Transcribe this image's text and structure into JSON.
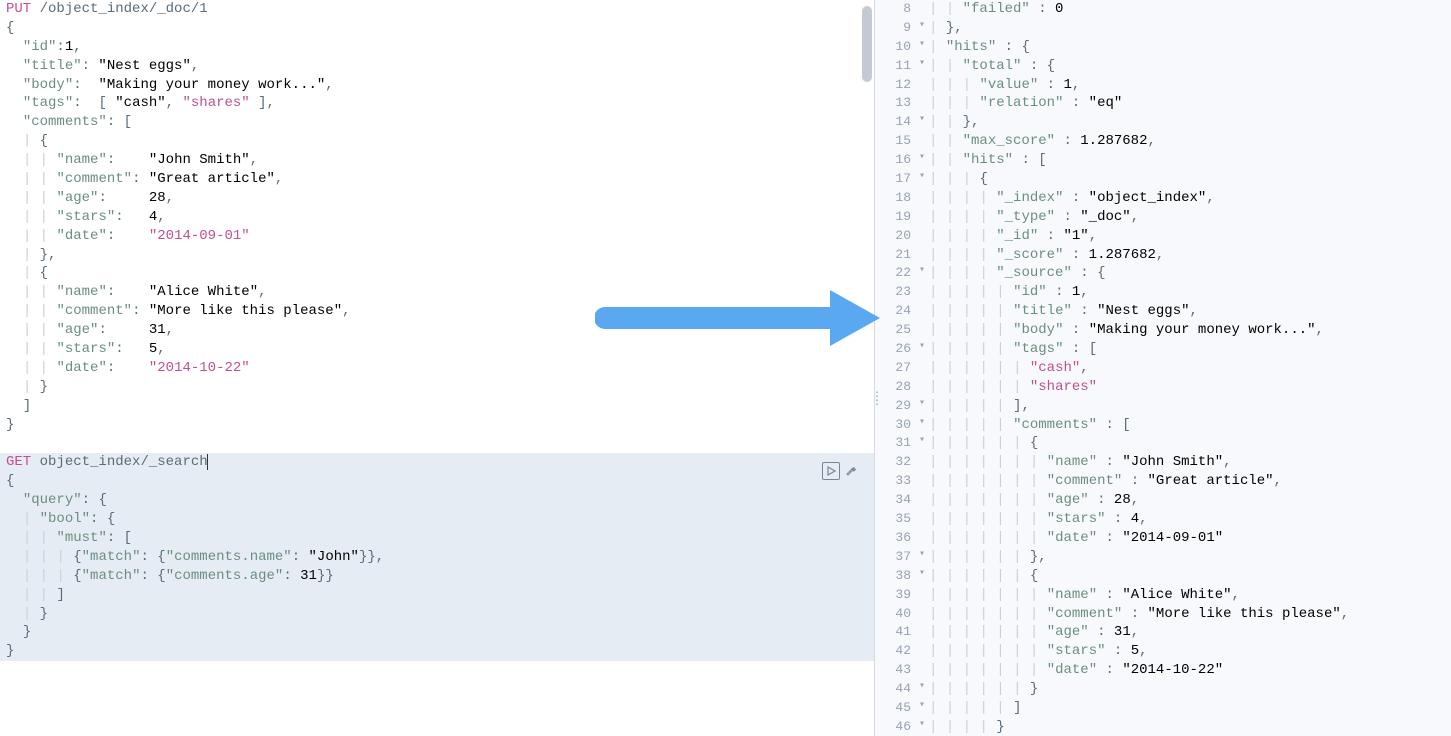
{
  "left": {
    "request1": {
      "method": "PUT",
      "path": "/object_index/_doc/1",
      "body_lines": [
        "{",
        "  \"id\":1,",
        "  \"title\": \"Nest eggs\",",
        "  \"body\":  \"Making your money work...\",",
        "  \"tags\":  [ \"cash\", \"shares\" ],",
        "  \"comments\": [",
        "    {",
        "      \"name\":    \"John Smith\",",
        "      \"comment\": \"Great article\",",
        "      \"age\":     28,",
        "      \"stars\":   4,",
        "      \"date\":    \"2014-09-01\"",
        "    },",
        "    {",
        "      \"name\":    \"Alice White\",",
        "      \"comment\": \"More like this please\",",
        "      \"age\":     31,",
        "      \"stars\":   5,",
        "      \"date\":    \"2014-10-22\"",
        "    }",
        "  ]",
        "}"
      ]
    },
    "request2": {
      "method": "GET",
      "path": "object_index/_search",
      "body_lines": [
        "{",
        "  \"query\": {",
        "    \"bool\": {",
        "      \"must\": [",
        "        {\"match\": {\"comments.name\": \"John\"}},",
        "        {\"match\": {\"comments.age\": 31}}",
        "      ]",
        "    }",
        "  }",
        "}"
      ]
    }
  },
  "right": {
    "lines": [
      {
        "n": 8,
        "f": "",
        "t": "    \"failed\" : 0"
      },
      {
        "n": 9,
        "f": "▾",
        "t": "  },"
      },
      {
        "n": 10,
        "f": "▾",
        "t": "  \"hits\" : {"
      },
      {
        "n": 11,
        "f": "▾",
        "t": "    \"total\" : {"
      },
      {
        "n": 12,
        "f": "",
        "t": "      \"value\" : 1,"
      },
      {
        "n": 13,
        "f": "",
        "t": "      \"relation\" : \"eq\""
      },
      {
        "n": 14,
        "f": "▾",
        "t": "    },"
      },
      {
        "n": 15,
        "f": "",
        "t": "    \"max_score\" : 1.287682,"
      },
      {
        "n": 16,
        "f": "▾",
        "t": "    \"hits\" : ["
      },
      {
        "n": 17,
        "f": "▾",
        "t": "      {"
      },
      {
        "n": 18,
        "f": "",
        "t": "        \"_index\" : \"object_index\","
      },
      {
        "n": 19,
        "f": "",
        "t": "        \"_type\" : \"_doc\","
      },
      {
        "n": 20,
        "f": "",
        "t": "        \"_id\" : \"1\","
      },
      {
        "n": 21,
        "f": "",
        "t": "        \"_score\" : 1.287682,"
      },
      {
        "n": 22,
        "f": "▾",
        "t": "        \"_source\" : {"
      },
      {
        "n": 23,
        "f": "",
        "t": "          \"id\" : 1,"
      },
      {
        "n": 24,
        "f": "",
        "t": "          \"title\" : \"Nest eggs\","
      },
      {
        "n": 25,
        "f": "",
        "t": "          \"body\" : \"Making your money work...\","
      },
      {
        "n": 26,
        "f": "▾",
        "t": "          \"tags\" : ["
      },
      {
        "n": 27,
        "f": "",
        "t": "            \"cash\","
      },
      {
        "n": 28,
        "f": "",
        "t": "            \"shares\""
      },
      {
        "n": 29,
        "f": "▾",
        "t": "          ],"
      },
      {
        "n": 30,
        "f": "▾",
        "t": "          \"comments\" : ["
      },
      {
        "n": 31,
        "f": "▾",
        "t": "            {"
      },
      {
        "n": 32,
        "f": "",
        "t": "              \"name\" : \"John Smith\","
      },
      {
        "n": 33,
        "f": "",
        "t": "              \"comment\" : \"Great article\","
      },
      {
        "n": 34,
        "f": "",
        "t": "              \"age\" : 28,"
      },
      {
        "n": 35,
        "f": "",
        "t": "              \"stars\" : 4,"
      },
      {
        "n": 36,
        "f": "",
        "t": "              \"date\" : \"2014-09-01\""
      },
      {
        "n": 37,
        "f": "▾",
        "t": "            },"
      },
      {
        "n": 38,
        "f": "▾",
        "t": "            {"
      },
      {
        "n": 39,
        "f": "",
        "t": "              \"name\" : \"Alice White\","
      },
      {
        "n": 40,
        "f": "",
        "t": "              \"comment\" : \"More like this please\","
      },
      {
        "n": 41,
        "f": "",
        "t": "              \"age\" : 31,"
      },
      {
        "n": 42,
        "f": "",
        "t": "              \"stars\" : 5,"
      },
      {
        "n": 43,
        "f": "",
        "t": "              \"date\" : \"2014-10-22\""
      },
      {
        "n": 44,
        "f": "▾",
        "t": "            }"
      },
      {
        "n": 45,
        "f": "▾",
        "t": "          ]"
      },
      {
        "n": 46,
        "f": "▾",
        "t": "        }"
      }
    ]
  }
}
